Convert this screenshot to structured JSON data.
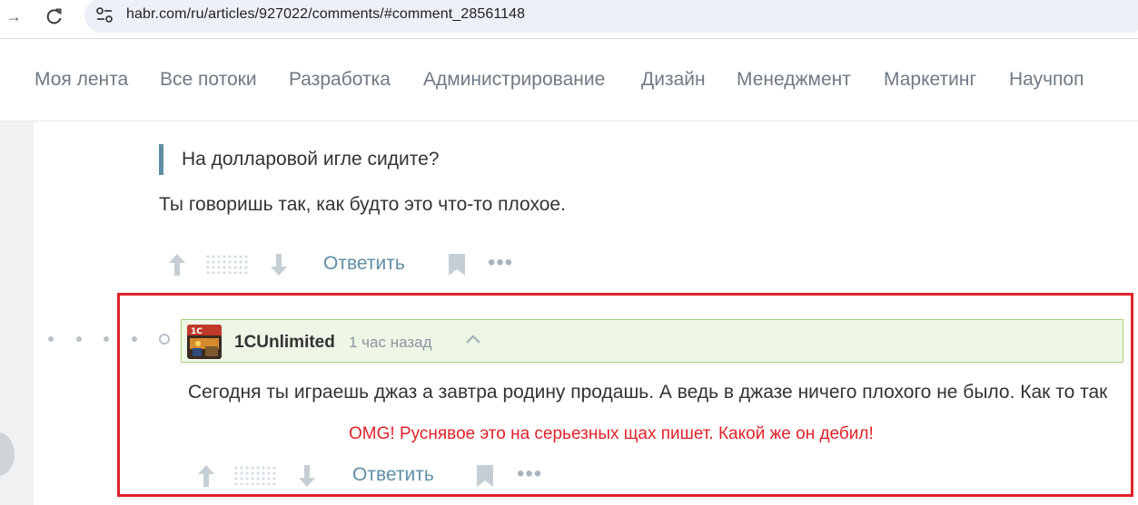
{
  "browser": {
    "url": "habr.com/ru/articles/927022/comments/#comment_28561148",
    "forward_icon": "arrow-right-icon",
    "reload_icon": "reload-icon",
    "site_settings_icon": "tune-icon"
  },
  "nav": {
    "items": [
      "Моя лента",
      "Все потоки",
      "Разработка",
      "Администрирование",
      "Дизайн",
      "Менеджмент",
      "Маркетинг",
      "Научпоп"
    ]
  },
  "parent_comment": {
    "quote": "На долларовой игле сидите?",
    "text": "Ты говоришь так, как будто это что-то плохое.",
    "reply_label": "Ответить"
  },
  "comment": {
    "author": "1CUnlimited",
    "time": "1 час назад",
    "text": "Сегодня ты играешь джаз а завтра родину продашь. А ведь в джазе ничего плохого не было. Как то так",
    "reply_label": "Ответить"
  },
  "annotation": {
    "text": "OMG! Руснявое это на серьезных щах пишет. Какой же он дебил!",
    "color": "#e0232a"
  },
  "colors": {
    "accent": "#5e8ea6",
    "highlight_bg": "#eef6e6",
    "highlight_border": "#a9d380"
  }
}
